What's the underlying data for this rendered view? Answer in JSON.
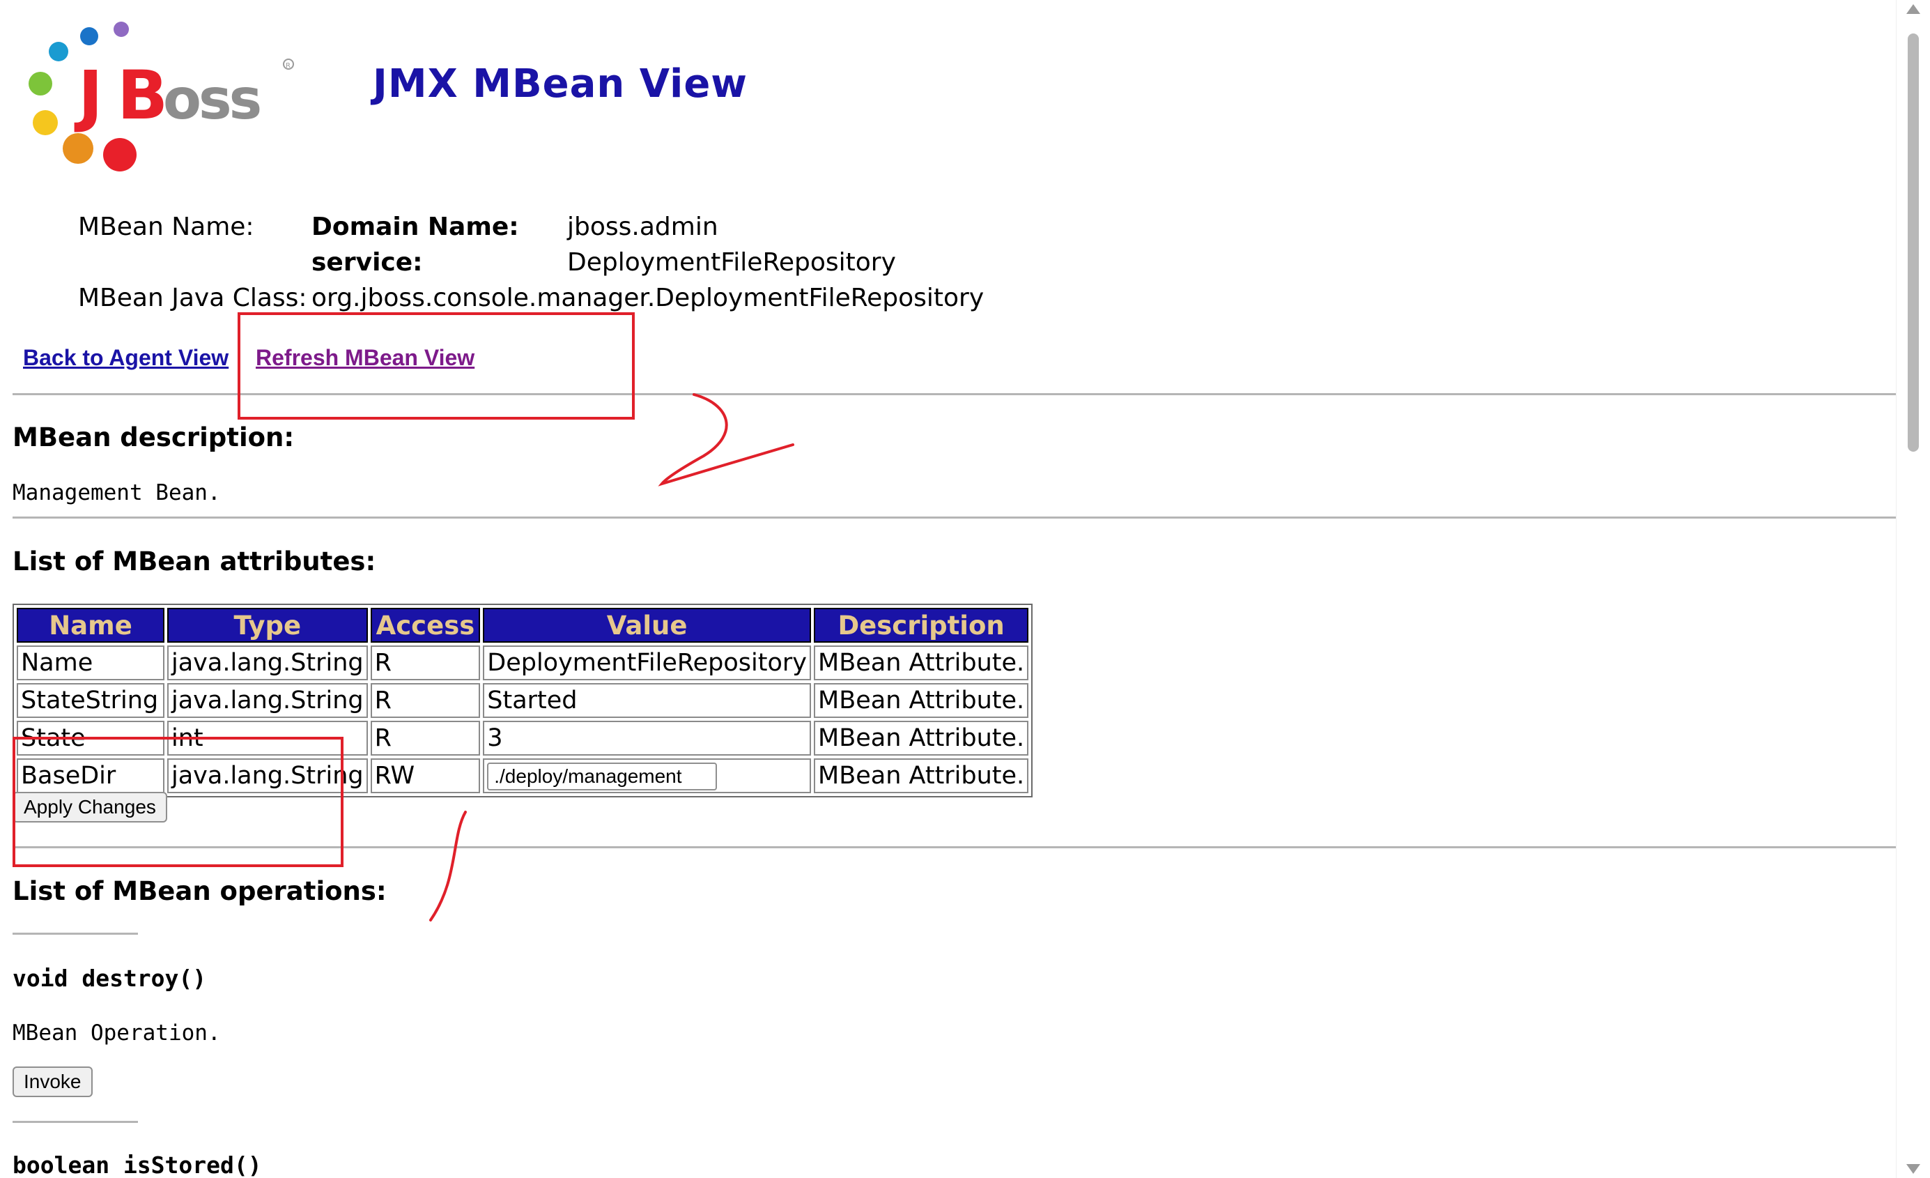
{
  "header": {
    "logo_text": "JBoss",
    "title": "JMX MBean View"
  },
  "mbean": {
    "name_label": "MBean Name:",
    "domain_key": "Domain Name:",
    "domain_value": "jboss.admin",
    "service_key": "service:",
    "service_value": "DeploymentFileRepository",
    "class_label": "MBean Java Class:",
    "class_value": "org.jboss.console.manager.DeploymentFileRepository"
  },
  "links": {
    "back": "Back to Agent View",
    "refresh": "Refresh MBean View"
  },
  "description": {
    "heading": "MBean description:",
    "text": "Management Bean."
  },
  "attributes": {
    "heading": "List of MBean attributes:",
    "columns": [
      "Name",
      "Type",
      "Access",
      "Value",
      "Description"
    ],
    "rows": [
      {
        "name": "Name",
        "type": "java.lang.String",
        "access": "R",
        "value": "DeploymentFileRepository",
        "description": "MBean Attribute."
      },
      {
        "name": "StateString",
        "type": "java.lang.String",
        "access": "R",
        "value": "Started",
        "description": "MBean Attribute."
      },
      {
        "name": "State",
        "type": "int",
        "access": "R",
        "value": "3",
        "description": "MBean Attribute."
      },
      {
        "name": "BaseDir",
        "type": "java.lang.String",
        "access": "RW",
        "value": "./deploy/management",
        "description": "MBean Attribute."
      }
    ],
    "apply_button": "Apply Changes"
  },
  "operations": {
    "heading": "List of MBean operations:",
    "items": [
      {
        "signature": "void destroy()",
        "description": "MBean Operation.",
        "button": "Invoke"
      },
      {
        "signature": "boolean isStored()"
      }
    ]
  },
  "colors": {
    "title_blue": "#1a13a6",
    "header_gold": "#e6c88c",
    "visited_link": "#7d1a8a",
    "annotation_red": "#e0202a"
  }
}
